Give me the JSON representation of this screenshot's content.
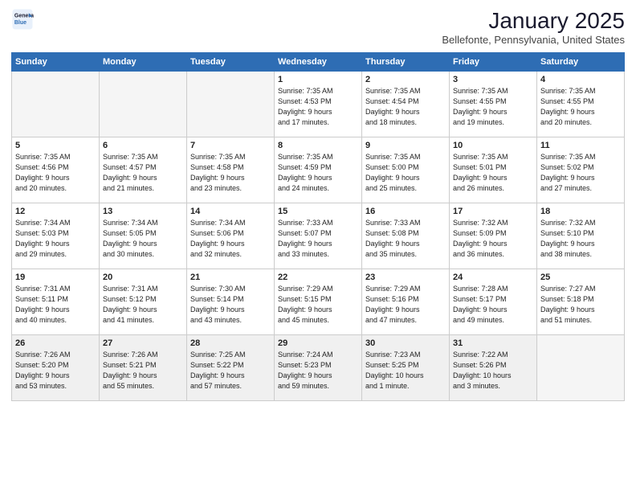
{
  "header": {
    "logo_line1": "General",
    "logo_line2": "Blue",
    "month": "January 2025",
    "location": "Bellefonte, Pennsylvania, United States"
  },
  "weekdays": [
    "Sunday",
    "Monday",
    "Tuesday",
    "Wednesday",
    "Thursday",
    "Friday",
    "Saturday"
  ],
  "weeks": [
    [
      {
        "day": "",
        "info": ""
      },
      {
        "day": "",
        "info": ""
      },
      {
        "day": "",
        "info": ""
      },
      {
        "day": "1",
        "info": "Sunrise: 7:35 AM\nSunset: 4:53 PM\nDaylight: 9 hours\nand 17 minutes."
      },
      {
        "day": "2",
        "info": "Sunrise: 7:35 AM\nSunset: 4:54 PM\nDaylight: 9 hours\nand 18 minutes."
      },
      {
        "day": "3",
        "info": "Sunrise: 7:35 AM\nSunset: 4:55 PM\nDaylight: 9 hours\nand 19 minutes."
      },
      {
        "day": "4",
        "info": "Sunrise: 7:35 AM\nSunset: 4:55 PM\nDaylight: 9 hours\nand 20 minutes."
      }
    ],
    [
      {
        "day": "5",
        "info": "Sunrise: 7:35 AM\nSunset: 4:56 PM\nDaylight: 9 hours\nand 20 minutes."
      },
      {
        "day": "6",
        "info": "Sunrise: 7:35 AM\nSunset: 4:57 PM\nDaylight: 9 hours\nand 21 minutes."
      },
      {
        "day": "7",
        "info": "Sunrise: 7:35 AM\nSunset: 4:58 PM\nDaylight: 9 hours\nand 23 minutes."
      },
      {
        "day": "8",
        "info": "Sunrise: 7:35 AM\nSunset: 4:59 PM\nDaylight: 9 hours\nand 24 minutes."
      },
      {
        "day": "9",
        "info": "Sunrise: 7:35 AM\nSunset: 5:00 PM\nDaylight: 9 hours\nand 25 minutes."
      },
      {
        "day": "10",
        "info": "Sunrise: 7:35 AM\nSunset: 5:01 PM\nDaylight: 9 hours\nand 26 minutes."
      },
      {
        "day": "11",
        "info": "Sunrise: 7:35 AM\nSunset: 5:02 PM\nDaylight: 9 hours\nand 27 minutes."
      }
    ],
    [
      {
        "day": "12",
        "info": "Sunrise: 7:34 AM\nSunset: 5:03 PM\nDaylight: 9 hours\nand 29 minutes."
      },
      {
        "day": "13",
        "info": "Sunrise: 7:34 AM\nSunset: 5:05 PM\nDaylight: 9 hours\nand 30 minutes."
      },
      {
        "day": "14",
        "info": "Sunrise: 7:34 AM\nSunset: 5:06 PM\nDaylight: 9 hours\nand 32 minutes."
      },
      {
        "day": "15",
        "info": "Sunrise: 7:33 AM\nSunset: 5:07 PM\nDaylight: 9 hours\nand 33 minutes."
      },
      {
        "day": "16",
        "info": "Sunrise: 7:33 AM\nSunset: 5:08 PM\nDaylight: 9 hours\nand 35 minutes."
      },
      {
        "day": "17",
        "info": "Sunrise: 7:32 AM\nSunset: 5:09 PM\nDaylight: 9 hours\nand 36 minutes."
      },
      {
        "day": "18",
        "info": "Sunrise: 7:32 AM\nSunset: 5:10 PM\nDaylight: 9 hours\nand 38 minutes."
      }
    ],
    [
      {
        "day": "19",
        "info": "Sunrise: 7:31 AM\nSunset: 5:11 PM\nDaylight: 9 hours\nand 40 minutes."
      },
      {
        "day": "20",
        "info": "Sunrise: 7:31 AM\nSunset: 5:12 PM\nDaylight: 9 hours\nand 41 minutes."
      },
      {
        "day": "21",
        "info": "Sunrise: 7:30 AM\nSunset: 5:14 PM\nDaylight: 9 hours\nand 43 minutes."
      },
      {
        "day": "22",
        "info": "Sunrise: 7:29 AM\nSunset: 5:15 PM\nDaylight: 9 hours\nand 45 minutes."
      },
      {
        "day": "23",
        "info": "Sunrise: 7:29 AM\nSunset: 5:16 PM\nDaylight: 9 hours\nand 47 minutes."
      },
      {
        "day": "24",
        "info": "Sunrise: 7:28 AM\nSunset: 5:17 PM\nDaylight: 9 hours\nand 49 minutes."
      },
      {
        "day": "25",
        "info": "Sunrise: 7:27 AM\nSunset: 5:18 PM\nDaylight: 9 hours\nand 51 minutes."
      }
    ],
    [
      {
        "day": "26",
        "info": "Sunrise: 7:26 AM\nSunset: 5:20 PM\nDaylight: 9 hours\nand 53 minutes."
      },
      {
        "day": "27",
        "info": "Sunrise: 7:26 AM\nSunset: 5:21 PM\nDaylight: 9 hours\nand 55 minutes."
      },
      {
        "day": "28",
        "info": "Sunrise: 7:25 AM\nSunset: 5:22 PM\nDaylight: 9 hours\nand 57 minutes."
      },
      {
        "day": "29",
        "info": "Sunrise: 7:24 AM\nSunset: 5:23 PM\nDaylight: 9 hours\nand 59 minutes."
      },
      {
        "day": "30",
        "info": "Sunrise: 7:23 AM\nSunset: 5:25 PM\nDaylight: 10 hours\nand 1 minute."
      },
      {
        "day": "31",
        "info": "Sunrise: 7:22 AM\nSunset: 5:26 PM\nDaylight: 10 hours\nand 3 minutes."
      },
      {
        "day": "",
        "info": ""
      }
    ]
  ]
}
